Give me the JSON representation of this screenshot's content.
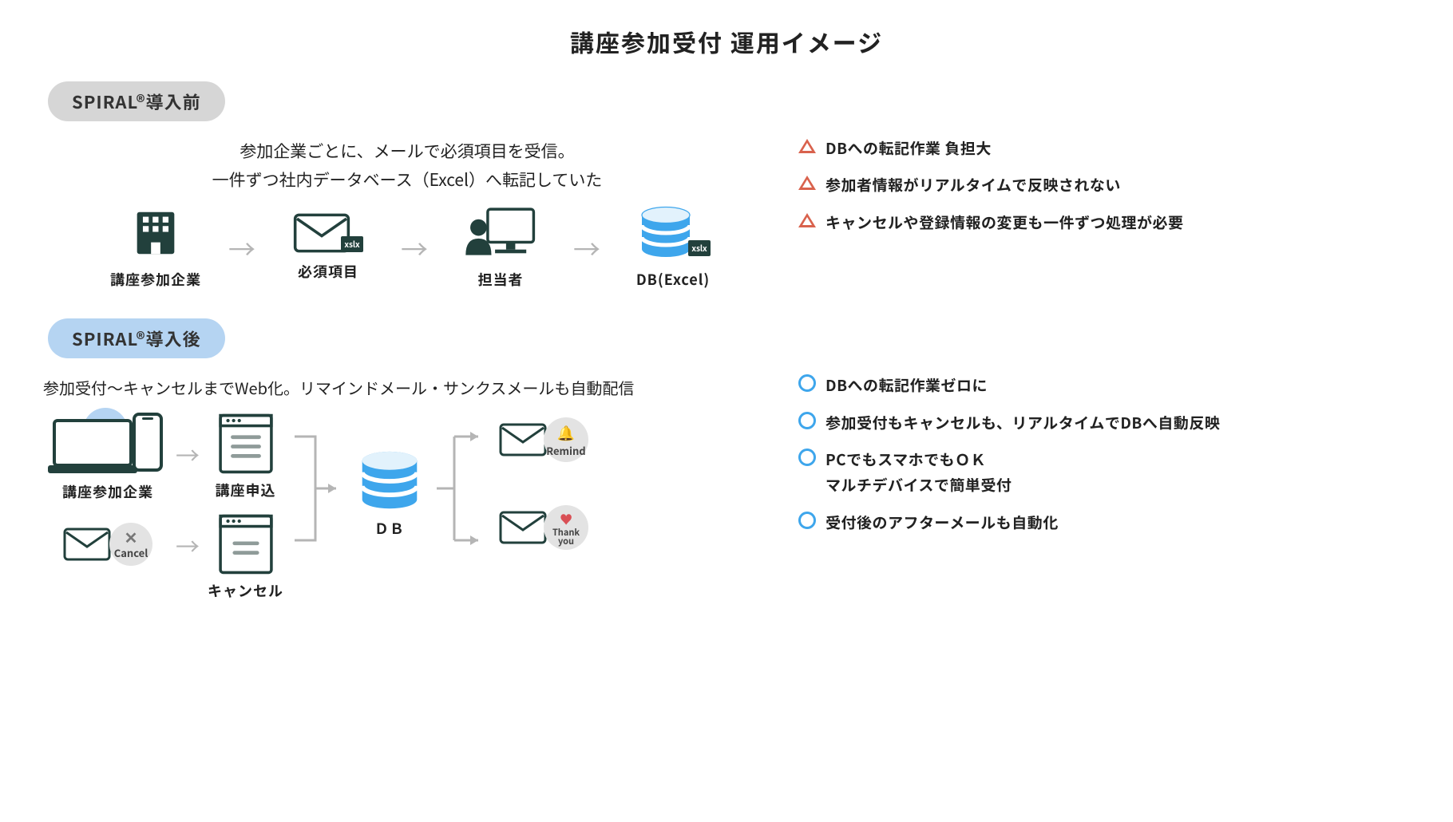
{
  "title": "講座参加受付 運用イメージ",
  "before": {
    "badge": "SPIRAL®導入前",
    "desc_line1": "参加企業ごとに、メールで必須項目を受信。",
    "desc_line2": "一件ずつ社内データベース（Excel）へ転記していた",
    "items": {
      "company": "講座参加企業",
      "required": "必須項目",
      "staff": "担当者",
      "db": "DB(Excel)",
      "xslx": "xslx"
    },
    "issues": [
      "DBへの転記作業 負担大",
      "参加者情報がリアルタイムで反映されない",
      "キャンセルや登録情報の変更も一件ずつ処理が必要"
    ]
  },
  "after": {
    "badge": "SPIRAL®導入後",
    "desc": "参加受付〜キャンセルまでWeb化。リマインドメール・サンクスメールも自動配信",
    "items": {
      "company": "講座参加企業",
      "apply": "講座申込",
      "cancel": "キャンセル",
      "cancel_badge": "Cancel",
      "db": "ＤＢ",
      "remind": "Remind",
      "thank": "Thank\nyou"
    },
    "benefits": [
      "DBへの転記作業ゼロに",
      "参加受付もキャンセルも、リアルタイムでDBへ自動反映",
      "PCでもスマホでもＯＫ\nマルチデバイスで簡単受付",
      "受付後のアフターメールも自動化"
    ]
  }
}
